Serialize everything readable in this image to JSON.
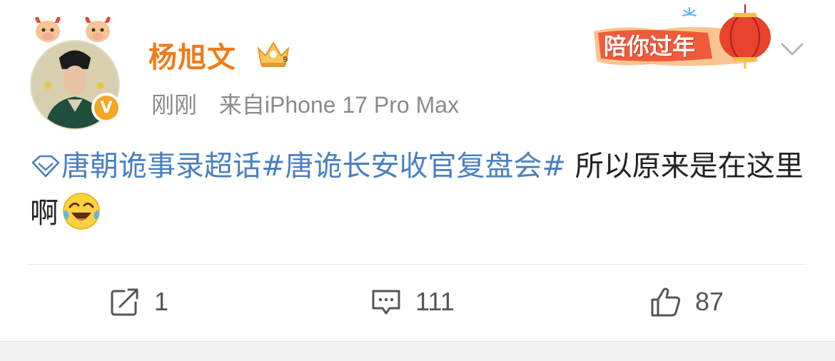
{
  "post": {
    "author": {
      "name": "杨旭文",
      "verified_mark": "V"
    },
    "meta": {
      "time": "刚刚",
      "source": "来自iPhone 17 Pro Max"
    },
    "banner": {
      "text": "陪你过年"
    },
    "content": {
      "super_topic": "唐朝诡事录超话",
      "hashtag": "#唐诡长安收官复盘会#",
      "text": " 所以原来是在这里啊",
      "emoji": "laugh-cry-emoji"
    },
    "actions": {
      "repost_count": "1",
      "comment_count": "111",
      "like_count": "87"
    }
  },
  "colors": {
    "username": "#f07c1a",
    "link": "#4a7fc1",
    "meta": "#8a8a8a",
    "verified": "#f5a623",
    "banner_red": "#e8432d"
  }
}
